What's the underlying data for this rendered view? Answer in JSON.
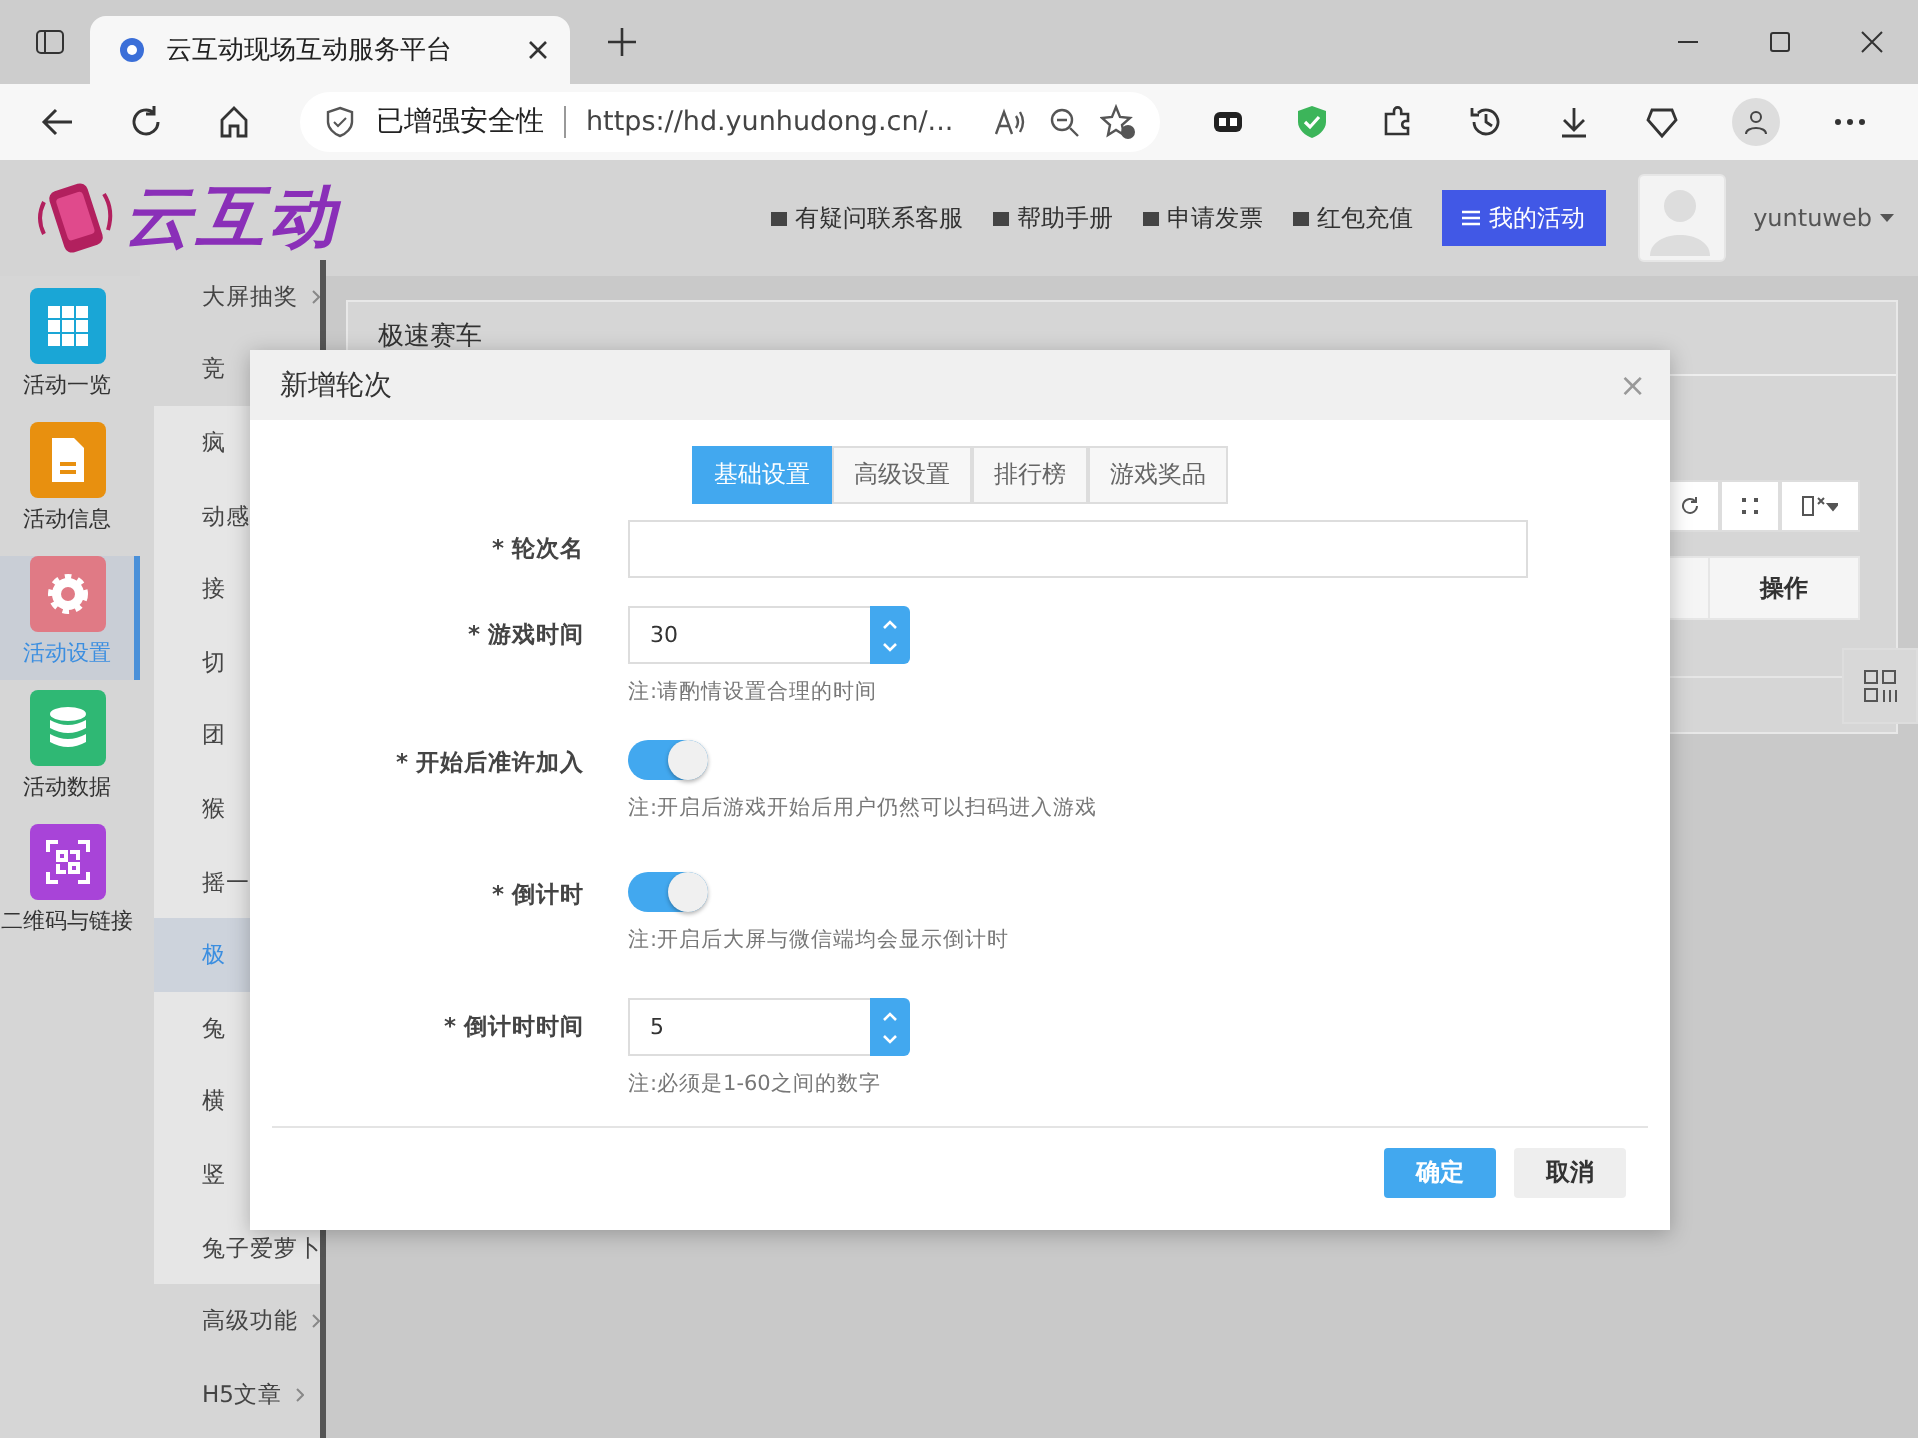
{
  "browser": {
    "tab_title": "云互动现场互动服务平台",
    "security": "已增强安全性",
    "url": "https://hd.yunhudong.cn/..."
  },
  "header": {
    "logo": "云互动",
    "links": [
      "有疑问联系客服",
      "帮助手册",
      "申请发票",
      "红包充值"
    ],
    "primary": "我的活动",
    "user": "yuntuweb"
  },
  "sidebar": [
    {
      "label": "活动一览",
      "selected": false,
      "color": "#1aa6d6"
    },
    {
      "label": "活动信息",
      "selected": false,
      "color": "#e8900f"
    },
    {
      "label": "活动设置",
      "selected": true,
      "color": "#e07a85"
    },
    {
      "label": "活动数据",
      "selected": false,
      "color": "#2fb874"
    },
    {
      "label": "二维码与链接",
      "selected": false,
      "color": "#a844d8"
    }
  ],
  "submenu": [
    {
      "label": "大屏抽奖",
      "selected": false,
      "expandable": true,
      "group": false
    },
    {
      "label": "竞",
      "selected": false,
      "expandable": false,
      "group": false
    },
    {
      "label": "疯",
      "selected": false,
      "expandable": false,
      "group": true
    },
    {
      "label": "动感",
      "selected": false,
      "expandable": false,
      "group": true
    },
    {
      "label": "接",
      "selected": false,
      "expandable": false,
      "group": true
    },
    {
      "label": "切",
      "selected": false,
      "expandable": false,
      "group": true
    },
    {
      "label": "团",
      "selected": false,
      "expandable": false,
      "group": true
    },
    {
      "label": "猴",
      "selected": false,
      "expandable": false,
      "group": true
    },
    {
      "label": "摇一",
      "selected": false,
      "expandable": false,
      "group": true
    },
    {
      "label": "极",
      "selected": true,
      "expandable": false,
      "group": true
    },
    {
      "label": "兔",
      "selected": false,
      "expandable": false,
      "group": true
    },
    {
      "label": "横",
      "selected": false,
      "expandable": false,
      "group": true
    },
    {
      "label": "竖",
      "selected": false,
      "expandable": false,
      "group": true
    },
    {
      "label": "兔子爱萝卜",
      "selected": false,
      "expandable": false,
      "group": true
    },
    {
      "label": "高级功能",
      "selected": false,
      "expandable": true,
      "group": false
    },
    {
      "label": "H5文章",
      "selected": false,
      "expandable": true,
      "group": false
    }
  ],
  "content": {
    "card_title": "极速赛车",
    "column": "操作"
  },
  "dialog": {
    "title": "新增轮次",
    "close": "×",
    "tabs": [
      {
        "label": "基础设置",
        "selected": true
      },
      {
        "label": "高级设置",
        "selected": false
      },
      {
        "label": "排行榜",
        "selected": false
      },
      {
        "label": "游戏奖品",
        "selected": false
      }
    ],
    "fields": [
      {
        "kind": "text",
        "label": "* 轮次名"
      },
      {
        "kind": "number",
        "label": "* 游戏时间",
        "value": "30",
        "note": "注:请酌情设置合理的时间"
      },
      {
        "kind": "switch",
        "label": "* 开始后准许加入",
        "on": true,
        "note": "注:开启后游戏开始后用户仍然可以扫码进入游戏"
      },
      {
        "kind": "switch",
        "label": "* 倒计时",
        "on": true,
        "note": "注:开启后大屏与微信端均会显示倒计时"
      },
      {
        "kind": "number",
        "label": "* 倒计时时间",
        "value": "5",
        "note": "注:必须是1-60之间的数字"
      }
    ],
    "buttons": [
      {
        "label": "确定",
        "kind": "primary"
      },
      {
        "label": "取消",
        "kind": "default"
      }
    ]
  }
}
